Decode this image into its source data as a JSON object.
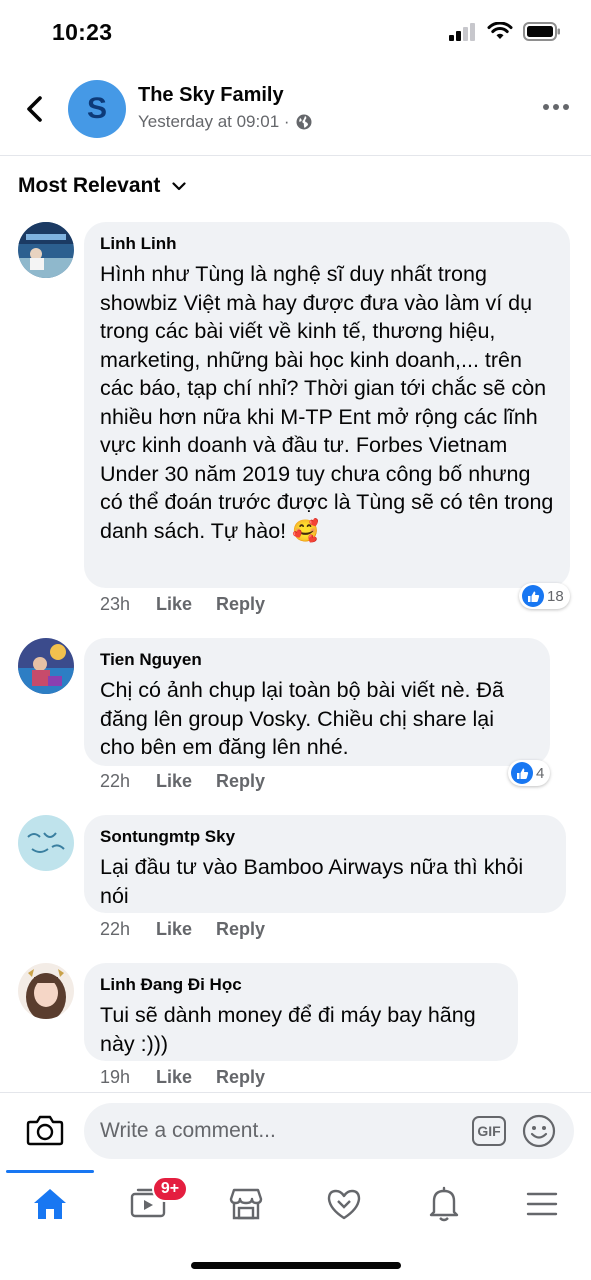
{
  "status_bar": {
    "time": "10:23"
  },
  "header": {
    "page_initial": "S",
    "page_name": "The Sky Family",
    "post_time": "Yesterday at 09:01 ·"
  },
  "sort": {
    "label": "Most Relevant"
  },
  "comments": [
    {
      "author": "Linh Linh",
      "text": "Hình như Tùng là nghệ sĩ duy nhất trong showbiz Việt mà hay được đưa vào làm ví dụ trong các bài viết về kinh tế, thương hiệu, marketing, những bài học kinh doanh,... trên các báo, tạp chí nhỉ? Thời gian tới chắc sẽ còn nhiều hơn nữa khi M-TP Ent mở rộng các lĩnh vực kinh doanh và đầu tư. Forbes Vietnam Under 30 năm 2019 tuy chưa công bố nhưng có thể đoán trước được là Tùng sẽ có tên trong danh sách. Tự hào! 🥰",
      "time": "23h",
      "like_label": "Like",
      "reply_label": "Reply",
      "reaction_count": "18"
    },
    {
      "author": "Tien Nguyen",
      "text": "Chị có ảnh chụp lại toàn bộ bài viết nè. Đã đăng lên group Vosky. Chiều chị share lại cho bên em đăng lên nhé.",
      "time": "22h",
      "like_label": "Like",
      "reply_label": "Reply",
      "reaction_count": "4"
    },
    {
      "author": "Sontungmtp Sky",
      "text": "Lại đầu tư vào Bamboo Airways nữa thì khỏi nói",
      "time": "22h",
      "like_label": "Like",
      "reply_label": "Reply"
    },
    {
      "author": "Linh Đang Đi Học",
      "text": "Tui sẽ dành money để đi máy bay hãng này :)))",
      "time": "19h",
      "like_label": "Like",
      "reply_label": "Reply"
    }
  ],
  "composer": {
    "placeholder": "Write a comment...",
    "gif_label": "GIF"
  },
  "tabbar": {
    "video_badge": "9+"
  },
  "colors": {
    "accent": "#1877f2",
    "badge": "#e41e3f",
    "bubble": "#f0f2f5",
    "secondary_text": "#65676b"
  }
}
